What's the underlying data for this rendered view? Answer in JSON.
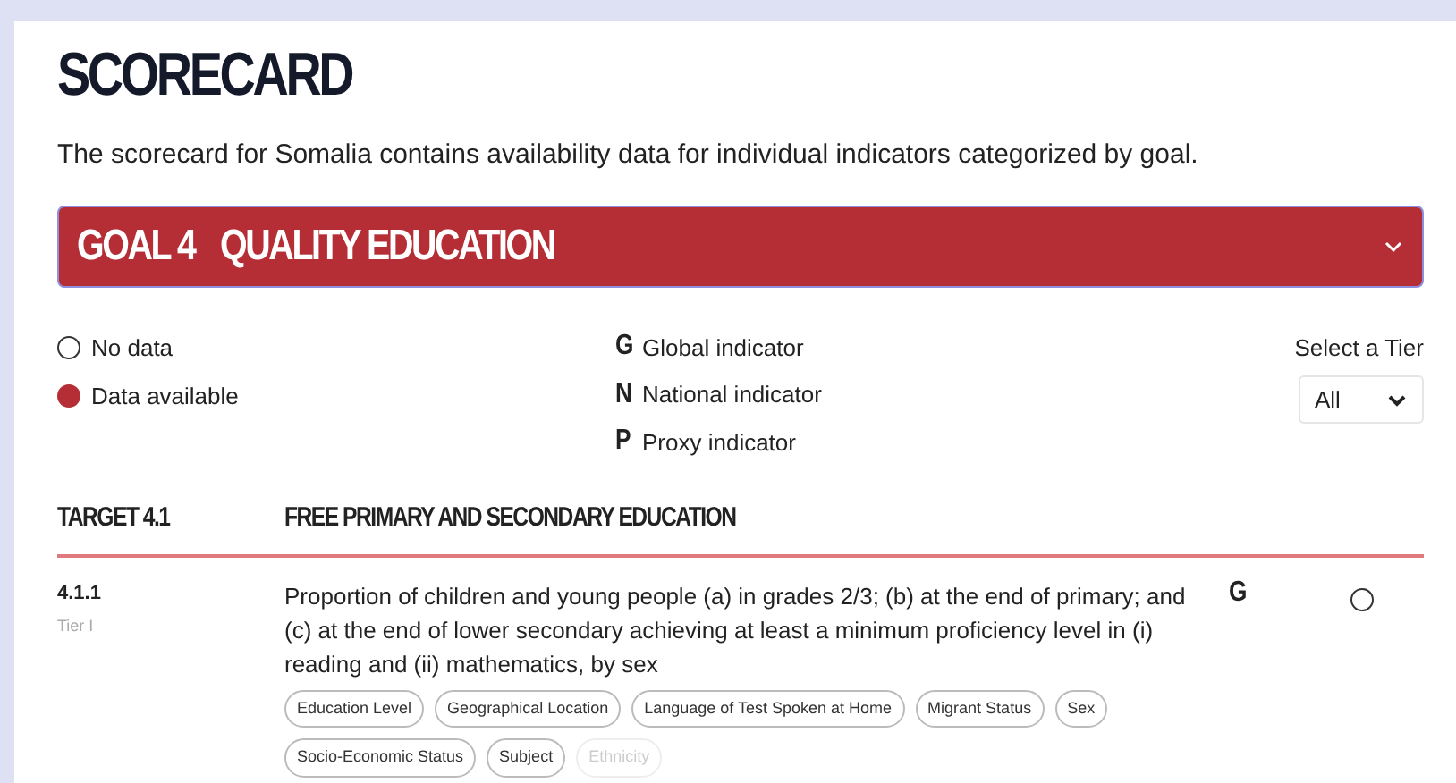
{
  "title": "SCORECARD",
  "intro": "The scorecard for Somalia contains availability data for individual indicators categorized by goal.",
  "goal": {
    "label": "GOAL 4",
    "name": "QUALITY EDUCATION",
    "expanded": true
  },
  "legend_status": [
    {
      "label": "No data",
      "available": false
    },
    {
      "label": "Data available",
      "available": true
    }
  ],
  "legend_types": [
    {
      "letter": "G",
      "label": "Global indicator"
    },
    {
      "letter": "N",
      "label": "National indicator"
    },
    {
      "letter": "P",
      "label": "Proxy indicator"
    }
  ],
  "tier_select": {
    "label": "Select a Tier",
    "value": "All"
  },
  "target": {
    "label": "TARGET 4.1",
    "name": "FREE PRIMARY AND SECONDARY EDUCATION"
  },
  "indicators": [
    {
      "code": "4.1.1",
      "tier": "Tier I",
      "text": "Proportion of children and young people (a) in grades 2/3; (b) at the end of primary; and (c) at the end of lower secondary achieving at least a minimum proficiency level in (i) reading and (ii) mathematics, by sex",
      "type": "G",
      "available": false,
      "tags": [
        {
          "label": "Education Level",
          "disabled": false
        },
        {
          "label": "Geographical Location",
          "disabled": false
        },
        {
          "label": "Language of Test Spoken at Home",
          "disabled": false
        },
        {
          "label": "Migrant Status",
          "disabled": false
        },
        {
          "label": "Sex",
          "disabled": false
        },
        {
          "label": "Socio-Economic Status",
          "disabled": false
        },
        {
          "label": "Subject",
          "disabled": false
        },
        {
          "label": "Ethnicity",
          "disabled": true
        }
      ]
    }
  ]
}
